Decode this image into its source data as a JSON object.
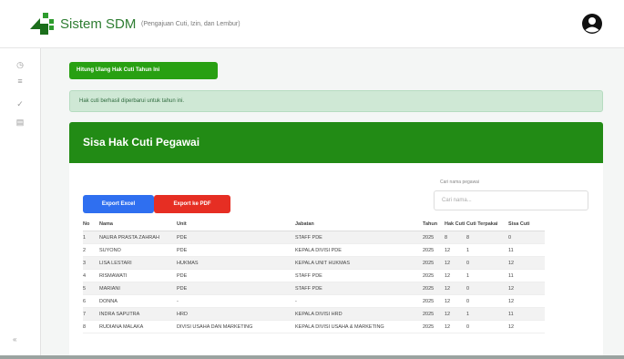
{
  "header": {
    "app_title": "Sistem SDM",
    "app_subtitle": "(Pengajuan Cuti, Izin, dan Lembur)",
    "logo_icon": "company-logo",
    "avatar_icon": "user-avatar-icon"
  },
  "sidebar": {
    "items": [
      {
        "icon": "dashboard-icon",
        "glyph": "◷"
      },
      {
        "icon": "list-icon",
        "glyph": "≡"
      },
      {
        "icon": "check-icon",
        "glyph": "✓"
      },
      {
        "icon": "document-icon",
        "glyph": "▤"
      }
    ],
    "collapse_glyph": "«"
  },
  "main": {
    "action_button": "Hitung Ulang Hak Cuti Tahun Ini",
    "alert_text": "Hak cuti berhasil diperbarui untuk tahun ini.",
    "card_title": "Sisa Hak Cuti Pegawai",
    "search": {
      "label": "Cari nama pegawai",
      "placeholder": "Cari nama..."
    },
    "export_excel": "Export Excel",
    "export_pdf": "Export ke PDF",
    "table": {
      "headers": [
        "No",
        "Nama",
        "Unit",
        "Jabatan",
        "Tahun",
        "Hak Cuti",
        "Cuti Terpakai",
        "Sisa Cuti"
      ],
      "rows": [
        [
          "1",
          "NAURA PRASTA ZAHRAH",
          "PDE",
          "STAFF PDE",
          "2025",
          "8",
          "8",
          "0"
        ],
        [
          "2",
          "SUYONO",
          "PDE",
          "KEPALA DIVISI PDE",
          "2025",
          "12",
          "1",
          "11"
        ],
        [
          "3",
          "LISA LESTARI",
          "HUKMAS",
          "KEPALA UNIT HUKMAS",
          "2025",
          "12",
          "0",
          "12"
        ],
        [
          "4",
          "RISMAWATI",
          "PDE",
          "STAFF PDE",
          "2025",
          "12",
          "1",
          "11"
        ],
        [
          "5",
          "MARIANI",
          "PDE",
          "STAFF PDE",
          "2025",
          "12",
          "0",
          "12"
        ],
        [
          "6",
          "DONNA",
          "-",
          "-",
          "2025",
          "12",
          "0",
          "12"
        ],
        [
          "7",
          "INDRA SAPUTRA",
          "HRD",
          "KEPALA DIVISI HRD",
          "2025",
          "12",
          "1",
          "11"
        ],
        [
          "8",
          "RUDIANA MALAKA",
          "DIVISI USAHA DAN MARKETING",
          "KEPALA DIVISI USAHA & MARKETING",
          "2025",
          "12",
          "0",
          "12"
        ]
      ]
    }
  },
  "colors": {
    "brand_green": "#228b15",
    "button_green": "#28a012",
    "excel_blue": "#2f6ff0",
    "pdf_red": "#e62e23",
    "alert_bg": "#cfe8d5"
  }
}
